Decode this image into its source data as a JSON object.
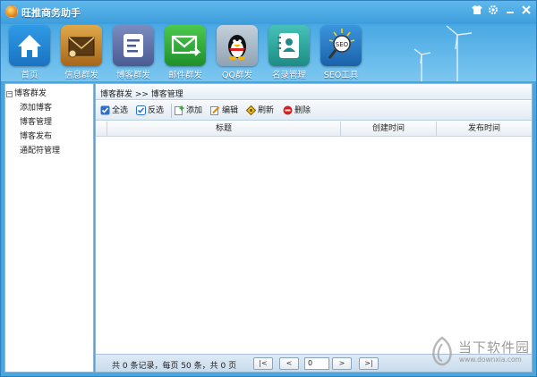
{
  "app": {
    "title": "旺推商务助手"
  },
  "window_controls": [
    "shirt-icon",
    "gear-icon",
    "minimize-icon",
    "close-icon"
  ],
  "nav": {
    "items": [
      {
        "label": "首页",
        "icon": "home-icon",
        "color": "#2d8fd8"
      },
      {
        "label": "信息群发",
        "icon": "envelope-icon",
        "color": "#c88a28"
      },
      {
        "label": "博客群发",
        "icon": "document-icon",
        "color": "#5a6fa8"
      },
      {
        "label": "邮件群发",
        "icon": "mail-send-icon",
        "color": "#2fa83a"
      },
      {
        "label": "QQ群发",
        "icon": "penguin-icon",
        "color": "#8fa3b4"
      },
      {
        "label": "名录管理",
        "icon": "contact-book-icon",
        "color": "#2aa9a0"
      },
      {
        "label": "SEO工具",
        "icon": "seo-magnifier-icon",
        "color": "#2b7cc7"
      }
    ]
  },
  "sidebar": {
    "root": {
      "label": "博客群发",
      "toggle": "−"
    },
    "items": [
      {
        "label": "添加博客"
      },
      {
        "label": "博客管理"
      },
      {
        "label": "博客发布"
      },
      {
        "label": "通配符管理"
      }
    ]
  },
  "breadcrumb": "博客群发 >> 博客管理",
  "toolbar": {
    "select_all": "全选",
    "invert": "反选",
    "add": "添加",
    "edit": "编辑",
    "refresh": "刷新",
    "delete": "删除"
  },
  "table": {
    "columns": [
      "标题",
      "创建时间",
      "发布时间"
    ],
    "rows": []
  },
  "pager": {
    "summary": "共 0 条记录，每页 50 条，共 0 页",
    "first": "|<",
    "prev": "<",
    "page_value": "0",
    "next": ">",
    "last": ">|"
  },
  "watermark": {
    "title": "当下软件园",
    "url": "www.downxia.com"
  }
}
